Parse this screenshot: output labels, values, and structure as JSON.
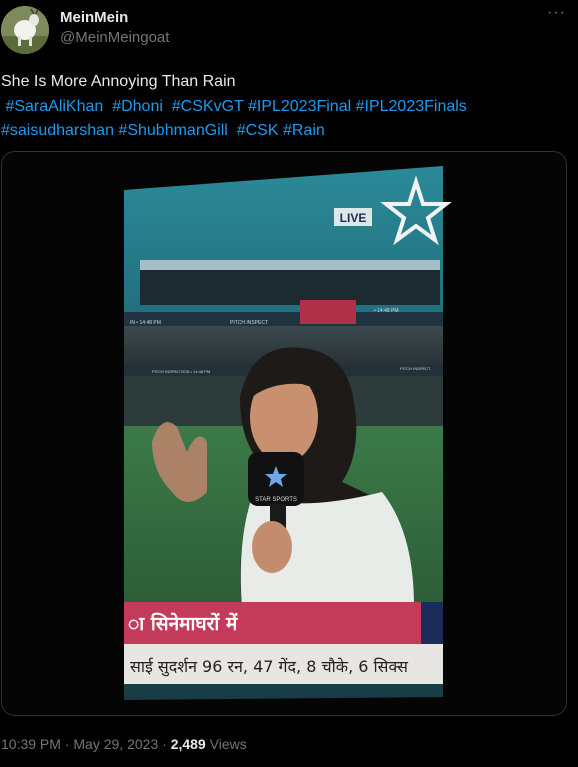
{
  "user": {
    "display_name": "MeinMein",
    "handle": "@MeinMeingoat"
  },
  "more_label": "···",
  "tweet": {
    "text": "She Is More Annoying Than Rain",
    "hashtags_line1": [
      "#SaraAliKhan",
      "#Dhoni",
      "#CSKvGT",
      "#IPL2023Final",
      "#IPL2023Finals"
    ],
    "hashtags_line2": [
      "#saisudharshan",
      "#ShubhmanGill",
      "#CSK",
      "#Rain"
    ]
  },
  "media": {
    "live_badge": "LIVE",
    "banner_text": "ा सिनेमाघरों में",
    "ticker_text": "साई सुदर्शन 96 रन, 47 गेंद, 8 चौके, 6 सिक्स",
    "mic_label": "STAR SPORTS",
    "ribbon_left": "IN • 14:48 PM",
    "ribbon_mid": "PITCH INSPECT",
    "ribbon_right": "• 14:48 PM",
    "ribbon2_left": "PITCH INSPECTION • 14:48 PM",
    "ribbon2_right": "PITCH INSPECT"
  },
  "meta": {
    "time": "10:39 PM",
    "separator": "·",
    "date": "May 29, 2023",
    "views_count": "2,489",
    "views_label": "Views"
  },
  "colors": {
    "accent": "#1d9bf0",
    "text": "#e7e9ea",
    "secondary": "#71767b",
    "border": "#2f3336"
  }
}
